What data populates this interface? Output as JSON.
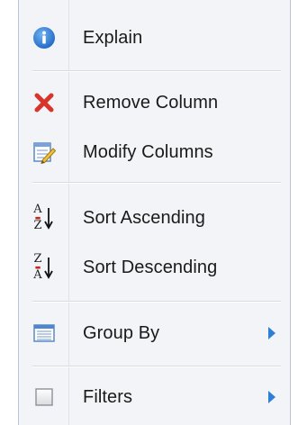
{
  "menu": {
    "items": [
      {
        "label": "Explain",
        "icon": "info-icon"
      },
      {
        "label": "Remove Column",
        "icon": "red-x-icon"
      },
      {
        "label": "Modify Columns",
        "icon": "edit-columns-icon"
      },
      {
        "label": "Sort Ascending",
        "icon": "sort-ascending-icon",
        "glyph_top": "A",
        "glyph_bottom": "Z"
      },
      {
        "label": "Sort Descending",
        "icon": "sort-descending-icon",
        "glyph_top": "Z",
        "glyph_bottom": "A"
      },
      {
        "label": "Group By",
        "icon": "group-by-icon",
        "has_submenu": true
      },
      {
        "label": "Filters",
        "icon": "checkbox-icon",
        "has_submenu": true
      }
    ]
  },
  "colors": {
    "menu_bg": "#f3f4f7",
    "accent_blue": "#2f7fd6",
    "remove_red": "#d9342b"
  }
}
